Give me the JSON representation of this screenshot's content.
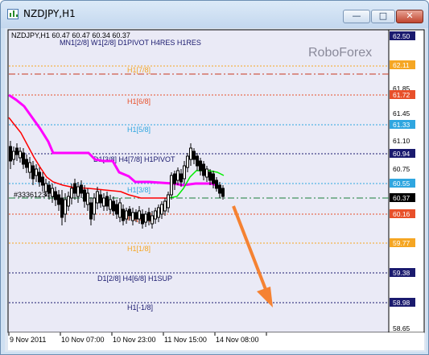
{
  "window": {
    "title": "NZDJPY,H1",
    "buttons": {
      "minimize": "—",
      "maximize": "□",
      "close": "✕"
    }
  },
  "chart": {
    "info_line": "NZDJPY,H1  60.47 60.47 60.34 60.37",
    "info_line2": "MN1[2/8] W1[2/8] D1PIVOT H4RES H1RES",
    "watermark": "RoboForex",
    "object_label": "#33361234 s",
    "colors": {
      "background": "#eaeaf6",
      "candles": "#000000",
      "ma_magenta": "#ff00ff",
      "ma_red": "#ff0000",
      "ma_green": "#00ee00",
      "arrow": "#f58232"
    },
    "price_axis_ticks": [
      "62.50",
      "62.11",
      "61.85",
      "61.72",
      "61.45",
      "61.33",
      "61.10",
      "60.94",
      "60.75",
      "60.55",
      "60.37",
      "60.16",
      "59.77",
      "59.38",
      "58.98",
      "58.65"
    ],
    "time_axis_labels": [
      "9 Nov 2011",
      "10 Nov 07:00",
      "10 Nov 23:00",
      "11 Nov 15:00",
      "14 Nov 08:00"
    ],
    "levels": [
      {
        "label": "H1[7/8]",
        "price": "62.11",
        "color": "#f5a623"
      },
      {
        "label": "H1[6/8]",
        "price": "61.72",
        "color": "#e8502a"
      },
      {
        "label": "H1[5/8]",
        "price": "61.33",
        "color": "#2fa6e0"
      },
      {
        "label": "D1[3/8] H4[7/8] H1PIVOT",
        "price": "60.94",
        "color": "#1a1a6e"
      },
      {
        "label": "H1[3/8]",
        "price": "60.55",
        "color": "#2fa6e0"
      },
      {
        "label": "H1[2/8]",
        "price": "60.16",
        "color": "#e8502a"
      },
      {
        "label": "H1[1/8]",
        "price": "59.77",
        "color": "#f5a623"
      },
      {
        "label": "D1[2/8] H4[6/8] H1SUP",
        "price": "59.38",
        "color": "#1a1a6e"
      },
      {
        "label": "H1[-1/8]",
        "price": "58.98",
        "color": "#1a1a6e"
      }
    ],
    "current_price": "60.37",
    "top_price_box": "62.50",
    "level_labels": {
      "l7": "H1[7/8]",
      "l6": "H1[6/8]",
      "l5": "H1[5/8]",
      "pivot": "D1[3/8] H4[7/8] H1PIVOT",
      "l3": "H1[3/8]",
      "l2": "H1[2/8]",
      "l1": "H1[1/8]",
      "sup": "D1[2/8] H4[6/8] H1SUP",
      "lm1": "H1[-1/8]"
    },
    "price_boxes": {
      "p6250": "62.50",
      "p6211": "62.11",
      "p6185": "61.85",
      "p6172": "61.72",
      "p6145": "61.45",
      "p6133": "61.33",
      "p6110": "61.10",
      "p6094": "60.94",
      "p6075": "60.75",
      "p6055": "60.55",
      "p6037": "60.37",
      "p6016": "60.16",
      "p5977": "59.77",
      "p5938": "59.38",
      "p5898": "58.98",
      "p5865": "58.65"
    },
    "time_labels": {
      "t1": "9 Nov 2011",
      "t2": "10 Nov 07:00",
      "t3": "10 Nov 23:00",
      "t4": "11 Nov 15:00",
      "t5": "14 Nov 08:00"
    }
  }
}
